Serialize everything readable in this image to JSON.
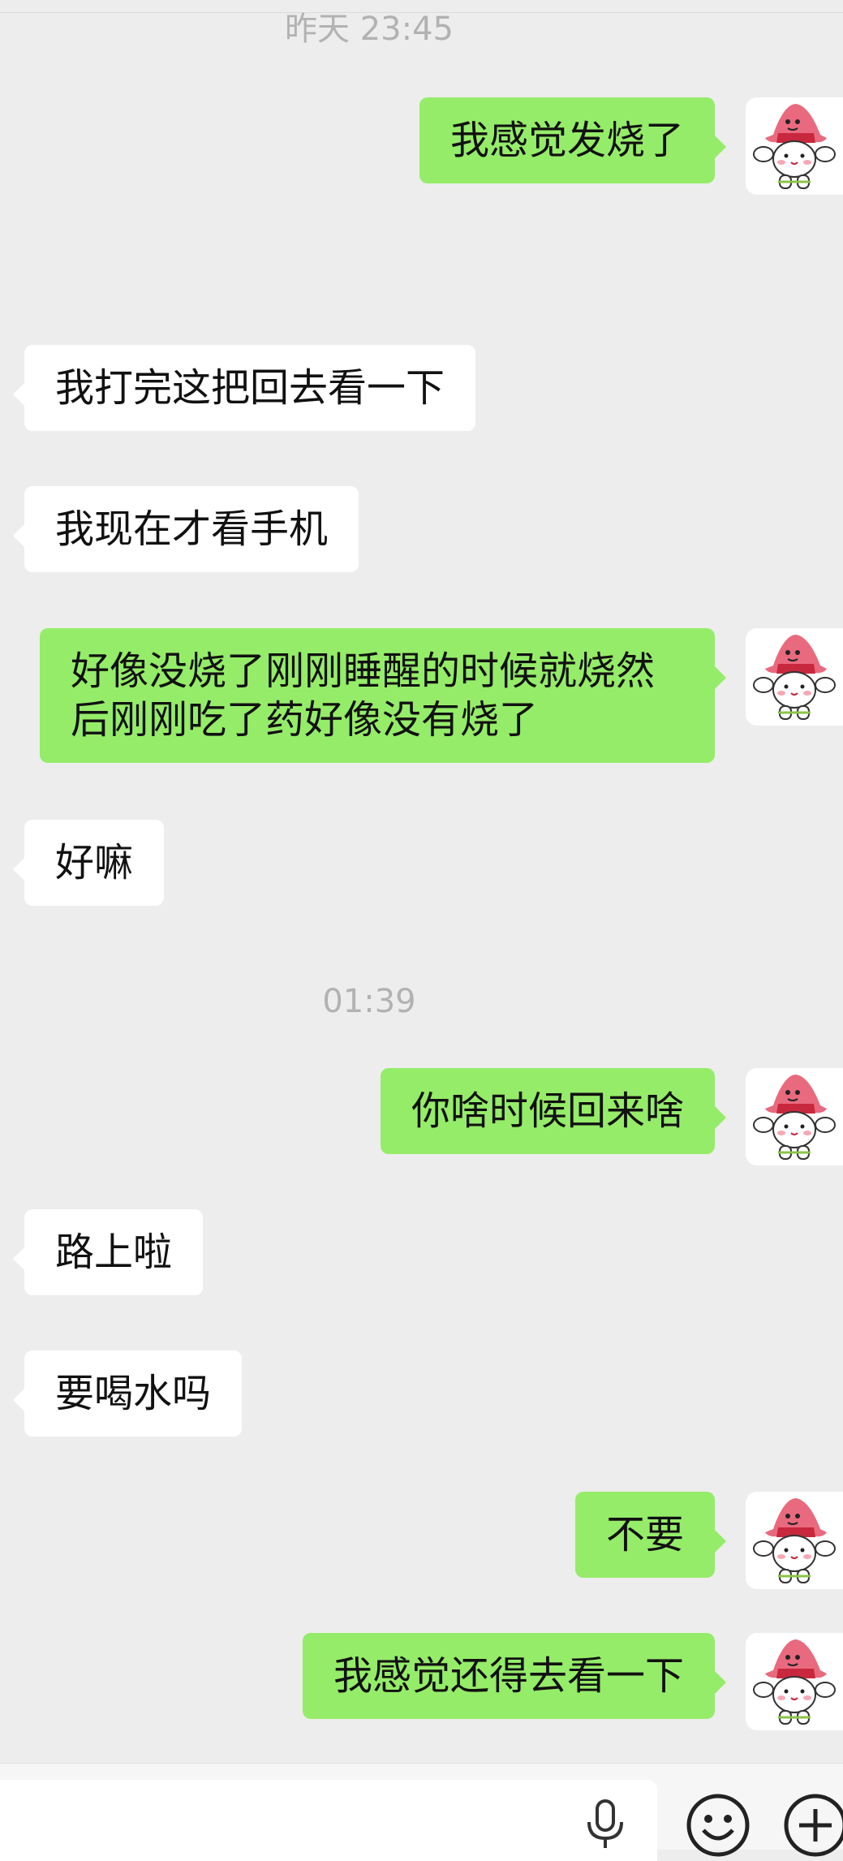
{
  "timestamps": [
    "昨天 23:45",
    "01:39"
  ],
  "messages": [
    {
      "side": "right",
      "text": "我感觉发烧了"
    },
    {
      "side": "left",
      "text": "我打完这把回去看一下"
    },
    {
      "side": "left",
      "text": "我现在才看手机"
    },
    {
      "side": "right",
      "text": "好像没烧了刚刚睡醒的时候就烧然后刚刚吃了药好像没有烧了"
    },
    {
      "side": "left",
      "text": "好嘛"
    },
    {
      "side": "right",
      "text": "你啥时候回来啥"
    },
    {
      "side": "left",
      "text": "路上啦"
    },
    {
      "side": "left",
      "text": "要喝水吗"
    },
    {
      "side": "right",
      "text": "不要"
    },
    {
      "side": "right",
      "text": "我感觉还得去看一下"
    }
  ],
  "colors": {
    "background": "#ededed",
    "bubble_sent": "#95ec69",
    "bubble_received": "#ffffff",
    "timestamp_text": "#b2b2b2"
  },
  "avatar": {
    "icon": "patrick-star-avatar-icon"
  },
  "input_bar": {
    "icons": [
      "microphone-icon",
      "emoji-icon",
      "plus-icon"
    ]
  }
}
